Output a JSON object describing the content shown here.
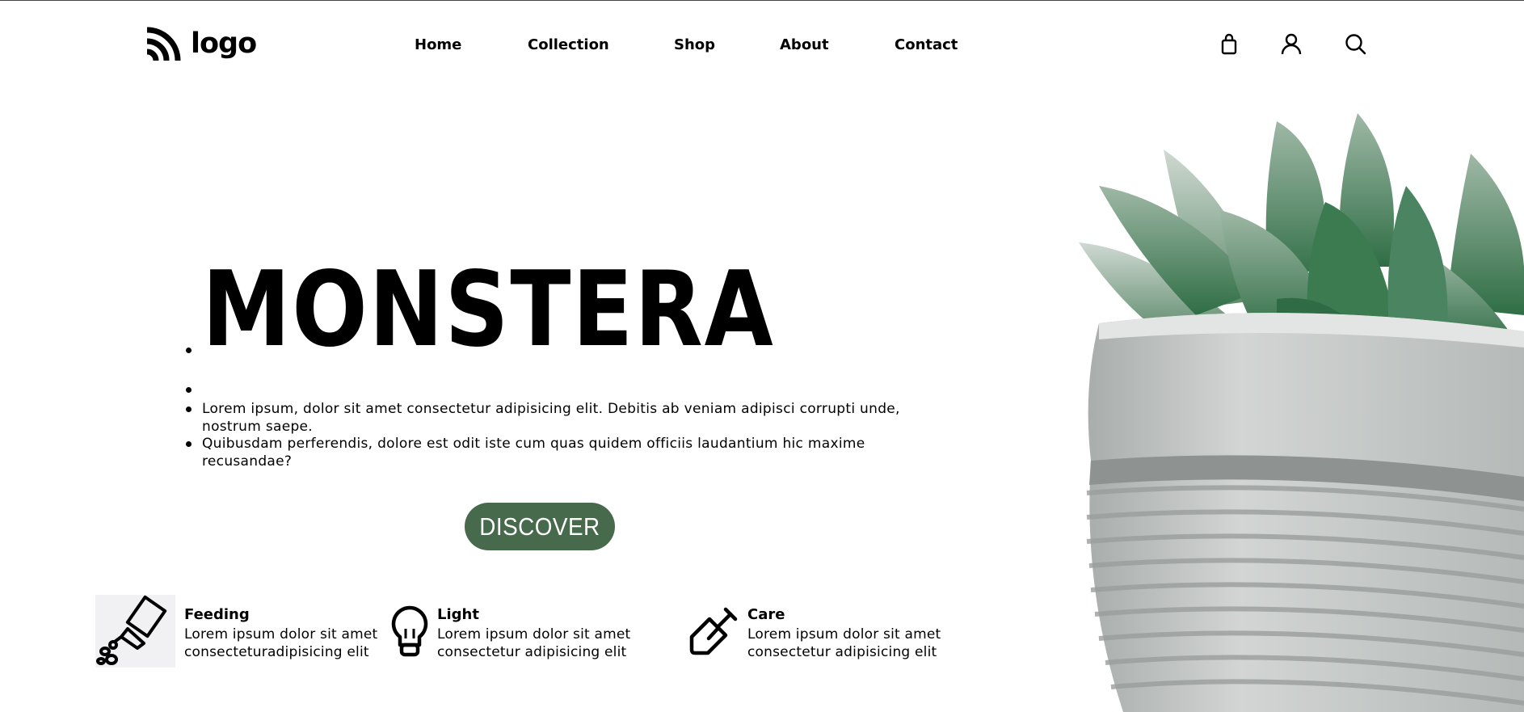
{
  "header": {
    "logo_text": "logo",
    "nav": [
      "Home",
      "Collection",
      "Shop",
      "About",
      "Contact"
    ],
    "icons": [
      "shopping-bag-icon",
      "user-icon",
      "search-icon"
    ]
  },
  "hero": {
    "title": "MONSTERA",
    "paragraphs": [
      "Lorem ipsum, dolor sit amet consectetur adipisicing elit. Debitis ab veniam adipisci corrupti unde,",
      "nostrum saepe.",
      "Quibusdam perferendis, dolore est odit iste cum quas quidem officiis laudantium hic maxime",
      "recusandae?"
    ],
    "button_label": "DISCOVER"
  },
  "features": [
    {
      "icon": "watering-can-icon",
      "title": "Feeding",
      "lines": [
        "Lorem ipsum dolor sit amet",
        "consecteturadipisicing elit"
      ]
    },
    {
      "icon": "light-bulb-icon",
      "title": "Light",
      "lines": [
        "Lorem ipsum dolor sit amet",
        "consectetur adipisicing elit"
      ]
    },
    {
      "icon": "shovel-icon",
      "title": "Care",
      "lines": [
        "Lorem ipsum dolor sit amet",
        "consectetur adipisicing elit"
      ]
    }
  ],
  "colors": {
    "button_bg": "#47694c",
    "button_text": "#ffffff",
    "text": "#000000",
    "pot": "#c3c7c6",
    "leaf": "#3f7a52"
  }
}
